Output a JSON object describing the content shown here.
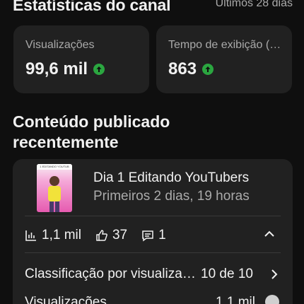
{
  "header": {
    "title": "Estatísticas do canal",
    "range": "Últimos 28 dias"
  },
  "stats": [
    {
      "label": "Visualizações",
      "value": "99,6 mil",
      "trend": "up",
      "trend_color": "#2ba640"
    },
    {
      "label": "Tempo de exibição (horas)",
      "value": "863",
      "trend": "up",
      "trend_color": "#2ba640"
    }
  ],
  "recent": {
    "title": "Conteúdo publicado recentemente",
    "video": {
      "title": "Dia 1 Editando YouTubers",
      "subtitle": "Primeiros 2 dias, 19 horas",
      "thumbnail_caption": "1 EDITANDO YOUTUB",
      "metrics": {
        "views": "1,1 mil",
        "likes": "37",
        "comments": "1"
      },
      "ranking_label": "Classificação por visualizações",
      "ranking_value": "10 de 10",
      "views_label": "Visualizações",
      "views_value": "1,1 mil"
    }
  },
  "icons": {
    "trend": "arrow-up-circle-icon",
    "views": "bar-chart-icon",
    "likes": "thumbs-up-icon",
    "comments": "comment-icon",
    "collapse": "chevron-up-icon",
    "open": "chevron-right-icon",
    "info": "info-icon"
  },
  "colors": {
    "background": "#0f0f0f",
    "card": "#212121",
    "accent_up": "#2ba640"
  }
}
